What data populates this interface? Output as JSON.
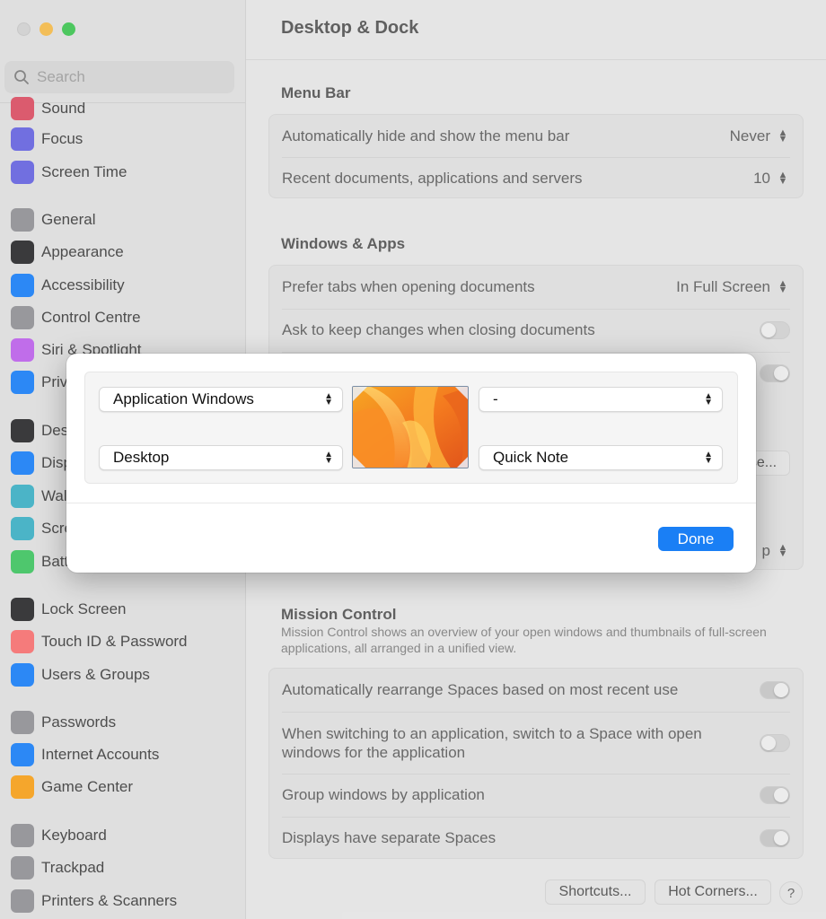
{
  "window": {
    "title": "Desktop & Dock"
  },
  "search": {
    "placeholder": "Search"
  },
  "sidebar": {
    "items": [
      {
        "label": "Sound",
        "icon": "speaker-icon",
        "color": "#e0445b"
      },
      {
        "label": "Focus",
        "icon": "moon-icon",
        "color": "#5e5ce6"
      },
      {
        "label": "Screen Time",
        "icon": "hourglass-icon",
        "color": "#5e5ce6"
      },
      {
        "label": "General",
        "icon": "gear-icon",
        "color": "#8e8e93"
      },
      {
        "label": "Appearance",
        "icon": "appearance-icon",
        "color": "#1c1c1e"
      },
      {
        "label": "Accessibility",
        "icon": "accessibility-icon",
        "color": "#0a7aff"
      },
      {
        "label": "Control Centre",
        "icon": "control-centre-icon",
        "color": "#8e8e93"
      },
      {
        "label": "Siri & Spotlight",
        "icon": "siri-icon",
        "color": "#bf5af2"
      },
      {
        "label": "Privacy & Security",
        "icon": "hand-icon",
        "color": "#0a7aff"
      },
      {
        "label": "Desktop & Dock",
        "icon": "dock-icon",
        "color": "#1c1c1e"
      },
      {
        "label": "Displays",
        "icon": "sun-icon",
        "color": "#0a7aff"
      },
      {
        "label": "Wallpaper",
        "icon": "wallpaper-icon",
        "color": "#30b0c7"
      },
      {
        "label": "Screen Saver",
        "icon": "screensaver-icon",
        "color": "#30b0c7"
      },
      {
        "label": "Battery",
        "icon": "battery-icon",
        "color": "#34c759"
      },
      {
        "label": "Lock Screen",
        "icon": "lock-icon",
        "color": "#1c1c1e"
      },
      {
        "label": "Touch ID & Password",
        "icon": "fingerprint-icon",
        "color": "#ff6b6b"
      },
      {
        "label": "Users & Groups",
        "icon": "users-icon",
        "color": "#0a7aff"
      },
      {
        "label": "Passwords",
        "icon": "key-icon",
        "color": "#8e8e93"
      },
      {
        "label": "Internet Accounts",
        "icon": "at-icon",
        "color": "#0a7aff"
      },
      {
        "label": "Game Center",
        "icon": "game-center-icon",
        "color": "#ff9f0a"
      },
      {
        "label": "Keyboard",
        "icon": "keyboard-icon",
        "color": "#8e8e93"
      },
      {
        "label": "Trackpad",
        "icon": "trackpad-icon",
        "color": "#8e8e93"
      },
      {
        "label": "Printers & Scanners",
        "icon": "printer-icon",
        "color": "#8e8e93"
      }
    ]
  },
  "main": {
    "menu_bar": {
      "title": "Menu Bar",
      "rows": [
        {
          "label": "Automatically hide and show the menu bar",
          "value": "Never"
        },
        {
          "label": "Recent documents, applications and servers",
          "value": "10"
        }
      ]
    },
    "windows_apps": {
      "title": "Windows & Apps",
      "rows": [
        {
          "label": "Prefer tabs when opening documents",
          "value": "In Full Screen"
        },
        {
          "label": "Ask to keep changes when closing documents",
          "toggle": false
        }
      ],
      "partial_button": "se...",
      "partial_value": "p"
    },
    "mission_control": {
      "title": "Mission Control",
      "description": "Mission Control shows an overview of your open windows and thumbnails of full-screen applications, all arranged in a unified view.",
      "rows": [
        {
          "label": "Automatically rearrange Spaces based on most recent use",
          "toggle": true
        },
        {
          "label": "When switching to an application, switch to a Space with open windows for the application",
          "toggle": false
        },
        {
          "label": "Group windows by application",
          "toggle": true
        },
        {
          "label": "Displays have separate Spaces",
          "toggle": true
        }
      ]
    },
    "footer": {
      "shortcuts": "Shortcuts...",
      "hot_corners": "Hot Corners...",
      "help": "?"
    }
  },
  "sheet": {
    "top_left": "Application Windows",
    "top_right": "-",
    "bottom_left": "Desktop",
    "bottom_right": "Quick Note",
    "done": "Done",
    "accent": "#1a7ff5"
  }
}
